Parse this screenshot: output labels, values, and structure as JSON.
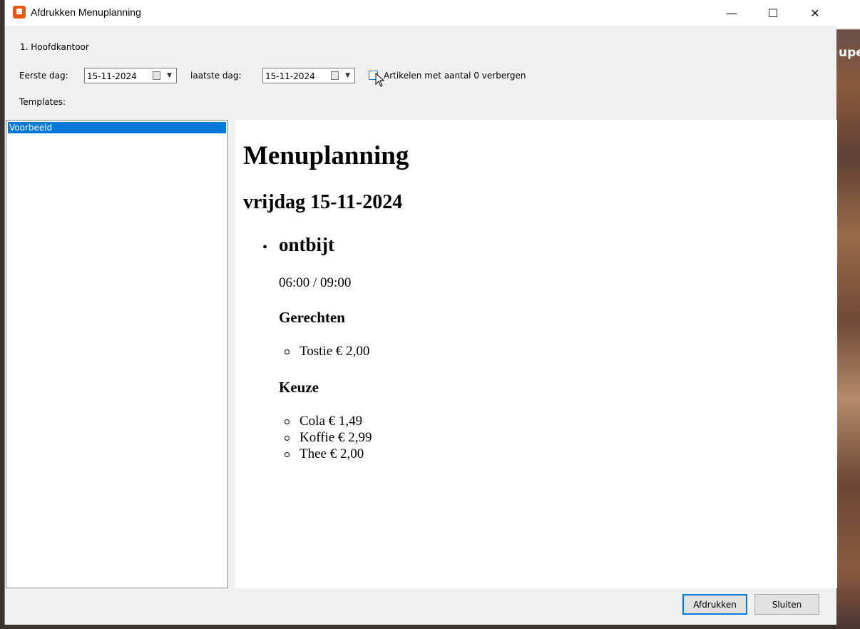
{
  "window": {
    "title": "Afdrukken Menuplanning",
    "minimize_glyph": "—",
    "maximize_glyph": "☐",
    "close_glyph": "✕"
  },
  "background": {
    "text": "upe"
  },
  "form": {
    "location": "1. Hoofdkantoor",
    "first_day_label": "Eerste dag:",
    "first_day_value": "15-11-2024",
    "last_day_label": "laatste dag:",
    "last_day_value": "15-11-2024",
    "hide_zero_label": "Artikelen met aantal 0 verbergen",
    "hide_zero_checked": false,
    "templates_label": "Templates:"
  },
  "templates": [
    {
      "label": "Voorbeeld",
      "selected": true
    }
  ],
  "preview": {
    "title": "Menuplanning",
    "date_heading": "vrijdag 15-11-2024",
    "meal": {
      "name": "ontbijt",
      "time": "06:00 / 09:00",
      "sections": [
        {
          "title": "Gerechten",
          "items": [
            "Tostie € 2,00"
          ]
        },
        {
          "title": "Keuze",
          "items": [
            "Cola € 1,49",
            "Koffie € 2,99",
            "Thee € 2,00"
          ]
        }
      ]
    }
  },
  "buttons": {
    "print": "Afdrukken",
    "close": "Sluiten"
  },
  "colors": {
    "accent": "#0078d7",
    "app_icon": "#e35b17",
    "selection": "#0078d7"
  }
}
